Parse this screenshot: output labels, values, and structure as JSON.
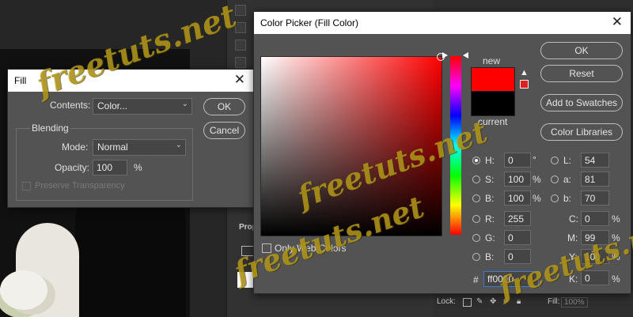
{
  "fill_dialog": {
    "title": "Fill",
    "contents_label": "Contents:",
    "contents_value": "Color...",
    "blending_label": "Blending",
    "mode_label": "Mode:",
    "mode_value": "Normal",
    "opacity_label": "Opacity:",
    "opacity_value": "100",
    "opacity_unit": "%",
    "preserve_label": "Preserve Transparency",
    "ok": "OK",
    "cancel": "Cancel"
  },
  "color_picker": {
    "title": "Color Picker (Fill Color)",
    "new_label": "new",
    "current_label": "current",
    "new_color": "#ff0000",
    "current_color": "#000000",
    "ok": "OK",
    "reset": "Reset",
    "add_swatches": "Add to Swatches",
    "color_libraries": "Color Libraries",
    "only_web": "Only Web Colors",
    "hsb": [
      {
        "label": "H:",
        "value": "0",
        "unit": "°"
      },
      {
        "label": "S:",
        "value": "100",
        "unit": "%"
      },
      {
        "label": "B:",
        "value": "100",
        "unit": "%"
      }
    ],
    "rgb": [
      {
        "label": "R:",
        "value": "255"
      },
      {
        "label": "G:",
        "value": "0"
      },
      {
        "label": "B:",
        "value": "0"
      }
    ],
    "lab": [
      {
        "label": "L:",
        "value": "54"
      },
      {
        "label": "a:",
        "value": "81"
      },
      {
        "label": "b:",
        "value": "70"
      }
    ],
    "cmyk": [
      {
        "label": "C:",
        "value": "0",
        "unit": "%"
      },
      {
        "label": "M:",
        "value": "99",
        "unit": "%"
      },
      {
        "label": "Y:",
        "value": "100",
        "unit": "%"
      },
      {
        "label": "K:",
        "value": "0",
        "unit": "%"
      }
    ],
    "hex_label": "#",
    "hex_value": "ff0000"
  },
  "background": {
    "properties_label": "Prop",
    "lock_label": "Lock:",
    "fill_label": "Fill:",
    "fill_value": "100%"
  },
  "watermark": "freetuts.net"
}
